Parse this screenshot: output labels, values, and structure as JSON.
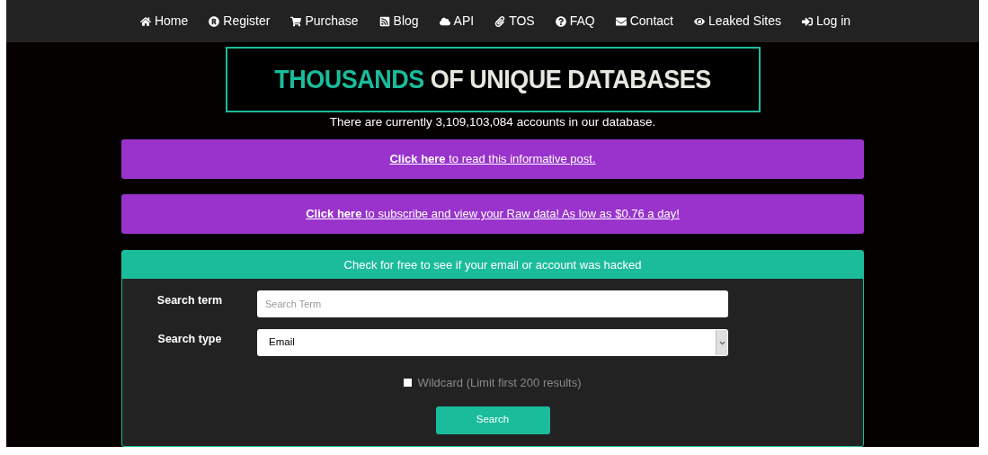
{
  "nav": [
    {
      "label": "Home"
    },
    {
      "label": "Register"
    },
    {
      "label": "Purchase"
    },
    {
      "label": "Blog"
    },
    {
      "label": "API"
    },
    {
      "label": "TOS"
    },
    {
      "label": "FAQ"
    },
    {
      "label": "Contact"
    },
    {
      "label": "Leaked Sites"
    },
    {
      "label": "Log in"
    }
  ],
  "hero": {
    "highlight": "THOUSANDS",
    "rest": "OF UNIQUE DATABASES"
  },
  "count_text": "There are currently 3,109,103,084 accounts in our database.",
  "banners": [
    {
      "text": "**Click here** to read this informative post."
    },
    {
      "text": "**Click here** to subscribe and view your Raw data! As low as $0.76 a day!"
    }
  ],
  "form": {
    "title": "Check for free to see if your email or account was hacked",
    "search_term": {
      "label": "Search term",
      "placeholder": "Search Term"
    },
    "search_type": {
      "label": "Search type",
      "value": "Email"
    },
    "wildcard": {
      "label": "Wildcard (Limit first 200 results)",
      "checked": false
    },
    "button": "Search"
  }
}
